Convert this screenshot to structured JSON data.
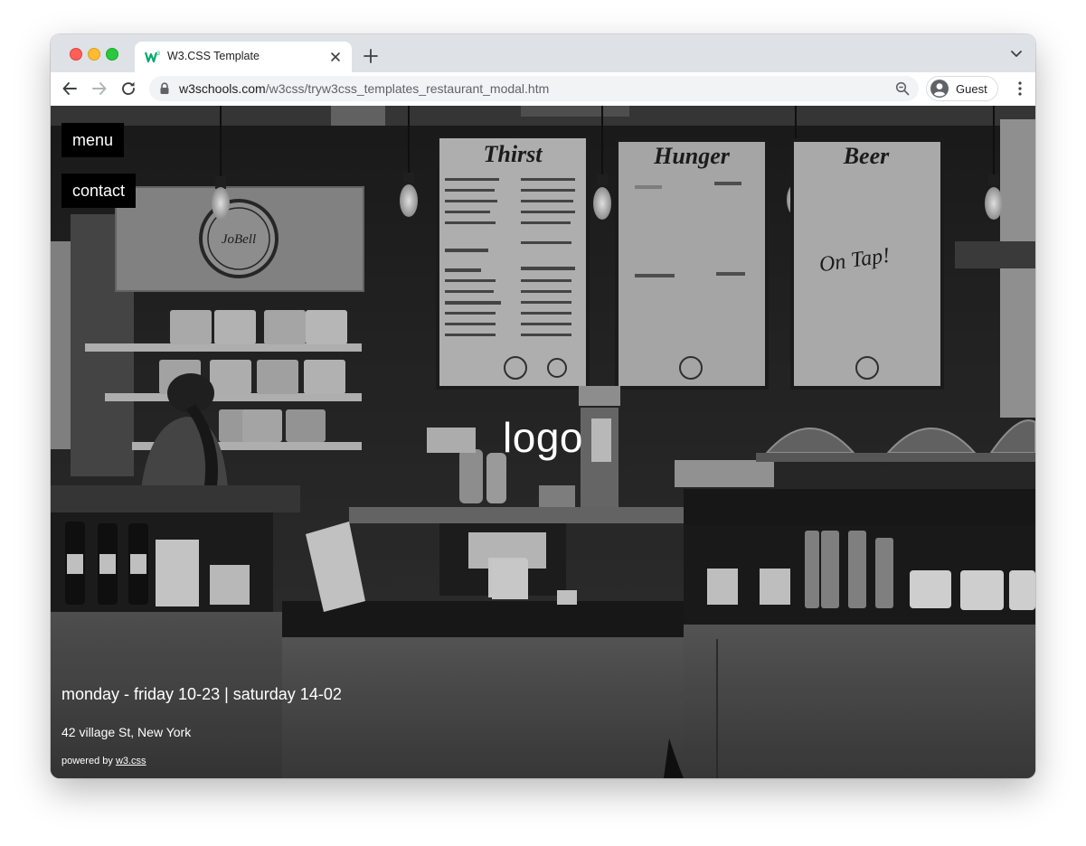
{
  "browser": {
    "tab_title": "W3.CSS Template",
    "url_host": "w3schools.com",
    "url_path": "/w3css/tryw3css_templates_restaurant_modal.htm",
    "profile_label": "Guest"
  },
  "page": {
    "nav": {
      "menu_label": "menu",
      "contact_label": "contact"
    },
    "logo": "logo",
    "hours": "monday - friday 10-23 | saturday 14-02",
    "address": "42 village St, New York",
    "powered_prefix": "powered by ",
    "powered_link": "w3.css",
    "board_titles": [
      "Thirst",
      "Hunger",
      "Beer"
    ],
    "board_beer_sub": "On Tap!",
    "sign_text": "JoBell"
  },
  "icons": {
    "close_tab": "close-icon",
    "new_tab": "plus-icon",
    "tab_search": "chevron-down-icon",
    "back": "arrow-left-icon",
    "forward": "arrow-right-icon",
    "reload": "reload-icon",
    "lock": "lock-icon",
    "zoom": "zoom-icon",
    "avatar": "avatar-icon",
    "more": "kebab-icon"
  },
  "colors": {
    "tabstrip_bg": "#dee1e6",
    "omnibox_bg": "#f1f3f4",
    "nav_button_bg": "#000000",
    "page_text": "#ffffff"
  }
}
